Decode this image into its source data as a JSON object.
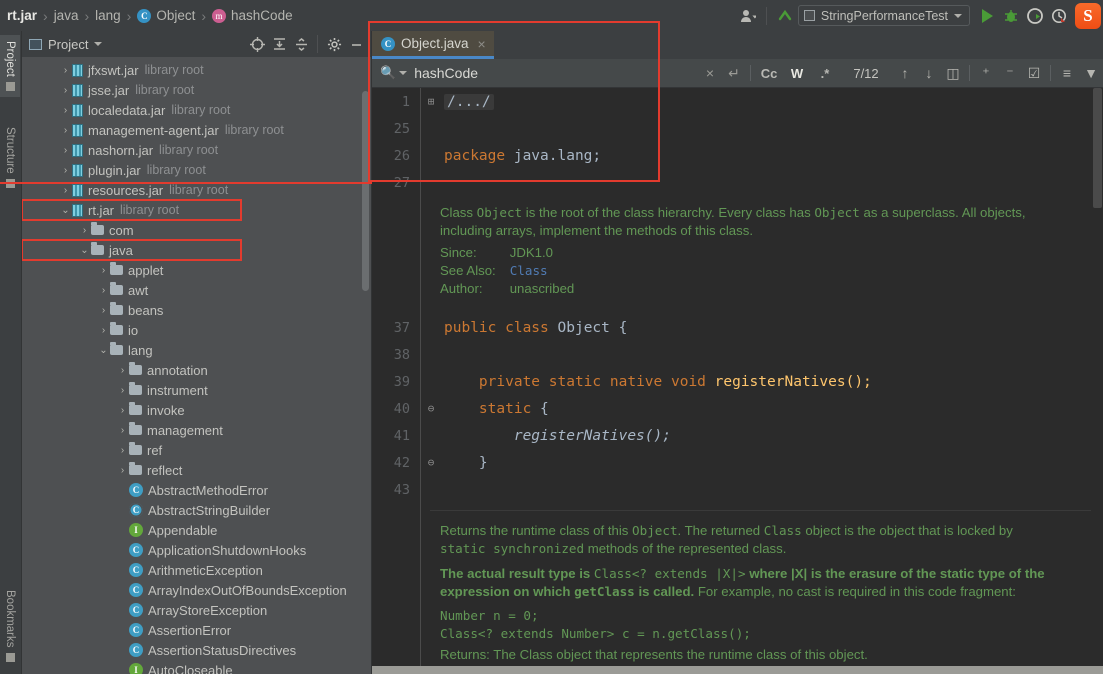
{
  "breadcrumb": {
    "items": [
      {
        "label": "rt.jar",
        "icon": "none",
        "bold": true
      },
      {
        "label": "java",
        "icon": "none",
        "bold": false
      },
      {
        "label": "lang",
        "icon": "none",
        "bold": false
      },
      {
        "label": "Object",
        "icon": "class-icon",
        "bold": false
      },
      {
        "label": "hashCode",
        "icon": "method-icon",
        "bold": false
      }
    ],
    "separator": "›"
  },
  "topright": {
    "user_icon": "user-icon",
    "updates_icon": "update-arrow-icon",
    "run_config": "StringPerformanceTest",
    "run_icon": "run-icon",
    "debug_icon": "debug-icon",
    "run_coverage_icon": "run-with-coverage-icon",
    "profile_icon": "profile-icon",
    "ime_icon": "sogou-ime-icon",
    "ime_label": "S"
  },
  "tool_tabs": [
    {
      "label": "Project",
      "active": true,
      "icon": "project-icon"
    },
    {
      "label": "Structure",
      "active": false,
      "icon": "structure-icon"
    },
    {
      "label": "Bookmarks",
      "active": false,
      "icon": "bookmarks-icon"
    }
  ],
  "project_panel": {
    "title": "Project",
    "toolbar_icons": [
      "locate-icon",
      "expand-all-icon",
      "collapse-all-icon",
      "gear-icon",
      "minimize-icon"
    ],
    "tree": [
      {
        "label": "jfxswt.jar",
        "suffix": "library root",
        "indent": 1,
        "arrow": "›",
        "icon": "jar-icon",
        "highlight": false
      },
      {
        "label": "jsse.jar",
        "suffix": "library root",
        "indent": 1,
        "arrow": "›",
        "icon": "jar-icon",
        "highlight": false
      },
      {
        "label": "localedata.jar",
        "suffix": "library root",
        "indent": 1,
        "arrow": "›",
        "icon": "jar-icon",
        "highlight": false
      },
      {
        "label": "management-agent.jar",
        "suffix": "library root",
        "indent": 1,
        "arrow": "›",
        "icon": "jar-icon",
        "highlight": false
      },
      {
        "label": "nashorn.jar",
        "suffix": "library root",
        "indent": 1,
        "arrow": "›",
        "icon": "jar-icon",
        "highlight": false
      },
      {
        "label": "plugin.jar",
        "suffix": "library root",
        "indent": 1,
        "arrow": "›",
        "icon": "jar-icon",
        "highlight": false
      },
      {
        "label": "resources.jar",
        "suffix": "library root",
        "indent": 1,
        "arrow": "›",
        "icon": "jar-icon",
        "highlight": false
      },
      {
        "label": "rt.jar",
        "suffix": "library root",
        "indent": 1,
        "arrow": "⌄",
        "icon": "jar-icon",
        "highlight": true
      },
      {
        "label": "com",
        "suffix": "",
        "indent": 2,
        "arrow": "›",
        "icon": "folder-icon",
        "highlight": false
      },
      {
        "label": "java",
        "suffix": "",
        "indent": 2,
        "arrow": "⌄",
        "icon": "folder-icon",
        "highlight": true
      },
      {
        "label": "applet",
        "suffix": "",
        "indent": 3,
        "arrow": "›",
        "icon": "folder-icon",
        "highlight": false
      },
      {
        "label": "awt",
        "suffix": "",
        "indent": 3,
        "arrow": "›",
        "icon": "folder-icon",
        "highlight": false
      },
      {
        "label": "beans",
        "suffix": "",
        "indent": 3,
        "arrow": "›",
        "icon": "folder-icon",
        "highlight": false
      },
      {
        "label": "io",
        "suffix": "",
        "indent": 3,
        "arrow": "›",
        "icon": "folder-icon",
        "highlight": false
      },
      {
        "label": "lang",
        "suffix": "",
        "indent": 3,
        "arrow": "⌄",
        "icon": "folder-icon",
        "highlight": false
      },
      {
        "label": "annotation",
        "suffix": "",
        "indent": 4,
        "arrow": "›",
        "icon": "folder-icon",
        "highlight": false
      },
      {
        "label": "instrument",
        "suffix": "",
        "indent": 4,
        "arrow": "›",
        "icon": "folder-icon",
        "highlight": false
      },
      {
        "label": "invoke",
        "suffix": "",
        "indent": 4,
        "arrow": "›",
        "icon": "folder-icon",
        "highlight": false
      },
      {
        "label": "management",
        "suffix": "",
        "indent": 4,
        "arrow": "›",
        "icon": "folder-icon",
        "highlight": false
      },
      {
        "label": "ref",
        "suffix": "",
        "indent": 4,
        "arrow": "›",
        "icon": "folder-icon",
        "highlight": false
      },
      {
        "label": "reflect",
        "suffix": "",
        "indent": 4,
        "arrow": "›",
        "icon": "folder-icon",
        "highlight": false
      },
      {
        "label": "AbstractMethodError",
        "suffix": "",
        "indent": 4,
        "arrow": "",
        "icon": "class-icon",
        "highlight": false
      },
      {
        "label": "AbstractStringBuilder",
        "suffix": "",
        "indent": 4,
        "arrow": "",
        "icon": "abstract-class-icon",
        "highlight": false
      },
      {
        "label": "Appendable",
        "suffix": "",
        "indent": 4,
        "arrow": "",
        "icon": "interface-icon",
        "highlight": false
      },
      {
        "label": "ApplicationShutdownHooks",
        "suffix": "",
        "indent": 4,
        "arrow": "",
        "icon": "class-icon",
        "highlight": false
      },
      {
        "label": "ArithmeticException",
        "suffix": "",
        "indent": 4,
        "arrow": "",
        "icon": "class-icon",
        "highlight": false
      },
      {
        "label": "ArrayIndexOutOfBoundsException",
        "suffix": "",
        "indent": 4,
        "arrow": "",
        "icon": "class-icon",
        "highlight": false
      },
      {
        "label": "ArrayStoreException",
        "suffix": "",
        "indent": 4,
        "arrow": "",
        "icon": "class-icon",
        "highlight": false
      },
      {
        "label": "AssertionError",
        "suffix": "",
        "indent": 4,
        "arrow": "",
        "icon": "class-icon",
        "highlight": false
      },
      {
        "label": "AssertionStatusDirectives",
        "suffix": "",
        "indent": 4,
        "arrow": "",
        "icon": "class-icon",
        "highlight": false
      },
      {
        "label": "AutoCloseable",
        "suffix": "",
        "indent": 4,
        "arrow": "",
        "icon": "interface-icon",
        "highlight": false
      }
    ]
  },
  "editor": {
    "tab": {
      "label": "Object.java",
      "icon": "java-class-icon",
      "close": "×"
    },
    "search": {
      "value": "hashCode",
      "magnifier": "search-icon",
      "clear": "×",
      "history": "↵",
      "toggles": [
        {
          "label": "Cc",
          "name": "match-case-toggle",
          "on": false
        },
        {
          "label": "W",
          "name": "words-toggle",
          "on": true
        },
        {
          "label": ".*",
          "name": "regex-toggle",
          "on": false
        }
      ],
      "match_count": "7/12",
      "nav_icons": [
        "find-previous-icon",
        "find-next-icon",
        "select-all-occurrences-icon",
        "add-line-icon",
        "remove-line-icon",
        "check-line-icon",
        "indent-icon",
        "filter-icon"
      ]
    },
    "lines": [
      {
        "num": "1",
        "fold": "⊞",
        "kind": "fold",
        "text": "/.../"
      },
      {
        "num": "25",
        "fold": "",
        "kind": "blank",
        "text": ""
      },
      {
        "num": "26",
        "fold": "",
        "kind": "package",
        "text": "package java.lang;"
      },
      {
        "num": "27",
        "fold": "",
        "kind": "blank",
        "text": ""
      },
      {
        "num": "37",
        "fold": "",
        "kind": "classdecl",
        "text": "public class Object {"
      },
      {
        "num": "38",
        "fold": "",
        "kind": "blank",
        "text": ""
      },
      {
        "num": "39",
        "fold": "",
        "kind": "method",
        "text": "private static native void registerNatives();"
      },
      {
        "num": "40",
        "fold": "⊖",
        "kind": "static",
        "text": "static {"
      },
      {
        "num": "41",
        "fold": "",
        "kind": "call",
        "text": "registerNatives();"
      },
      {
        "num": "42",
        "fold": "⊖",
        "kind": "brace",
        "text": "}"
      },
      {
        "num": "43",
        "fold": "",
        "kind": "blank",
        "text": ""
      }
    ],
    "code_tokens": {
      "package_kw": "package",
      "package_name": " java.lang;",
      "public_kw": "public ",
      "class_kw": "class ",
      "class_name": "Object",
      "open_brace": " {",
      "private_kw": "private ",
      "static_kw": "static ",
      "native_kw": "native ",
      "void_kw": "void ",
      "method_name": "registerNatives();",
      "static_block": "static ",
      "static_brace": "{",
      "call_text": "registerNatives();",
      "close_brace": "}",
      "fold_text": "/.../"
    },
    "javadoc_class": {
      "line1_a": "Class ",
      "line1_mono1": "Object",
      "line1_b": " is the root of the class hierarchy. Every class has ",
      "line1_mono2": "Object",
      "line1_c": " as a superclass. All objects,",
      "line2": "including arrays, implement the methods of this class.",
      "rows": [
        {
          "label": "Since:",
          "value": "JDK1.0",
          "link": false
        },
        {
          "label": "See Also:",
          "value": "Class",
          "link": true
        },
        {
          "label": "Author:",
          "value": "unascribed",
          "link": false
        }
      ]
    },
    "javadoc_method": {
      "p1_a": "Returns the runtime class of this ",
      "p1_mono1": "Object",
      "p1_b": ". The returned ",
      "p1_mono2": "Class",
      "p1_c": " object is the object that is locked by",
      "p2_mono": "static synchronized",
      "p2_rest": " methods of the represented class.",
      "b1": "The actual result type is ",
      "b1_mono": "Class<? extends |X|>",
      "b2": " where |X| is the erasure of the static type of",
      "b3": "the expression on which ",
      "b3_mono": "getClass",
      "b4": " is called.",
      "b5": " For example, no cast is required in this code",
      "b6": "fragment:",
      "code1": "Number n = 0;",
      "code2": "Class<? extends Number> c = n.getClass();",
      "returns_line": "Returns: The Class object that represents the runtime class of this object."
    }
  },
  "annotations": {
    "highlight_color": "#e33b2e",
    "boxes": [
      "rt-jar-row",
      "java-folder-row",
      "search-overlay-region"
    ]
  }
}
